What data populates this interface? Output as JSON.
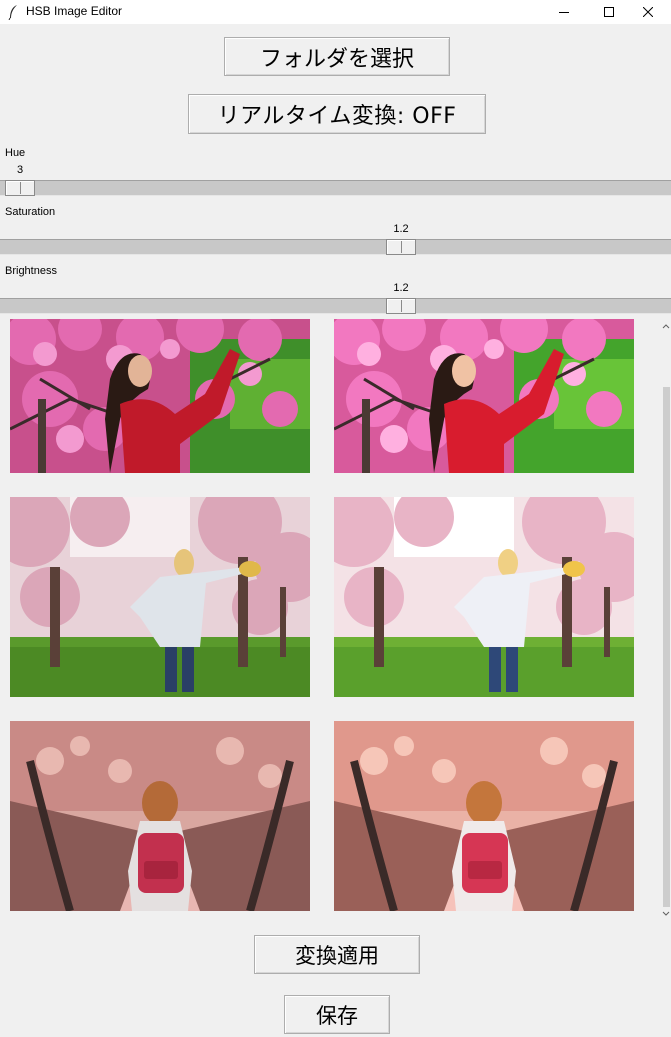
{
  "window": {
    "title": "HSB Image Editor"
  },
  "buttons": {
    "select_folder": "フォルダを選択",
    "realtime_toggle": "リアルタイム変換: OFF",
    "apply": "変換適用",
    "save": "保存"
  },
  "sliders": {
    "hue": {
      "label": "Hue",
      "value": "3"
    },
    "saturation": {
      "label": "Saturation",
      "value": "1.2"
    },
    "brightness": {
      "label": "Brightness",
      "value": "1.2"
    }
  },
  "images": [
    {
      "scene": "woman-red-dress-cherry-blossoms",
      "original": "original",
      "converted": "converted"
    },
    {
      "scene": "woman-with-hat-in-cherry-park",
      "original": "original",
      "converted": "converted"
    },
    {
      "scene": "girl-with-backpack-cherry-path",
      "original": "original",
      "converted": "converted"
    }
  ],
  "icons": {
    "app": "feather-icon",
    "minimize": "minimize-icon",
    "maximize": "maximize-icon",
    "close": "close-icon",
    "scroll_up": "chevron-up-icon",
    "scroll_down": "chevron-down-icon"
  }
}
